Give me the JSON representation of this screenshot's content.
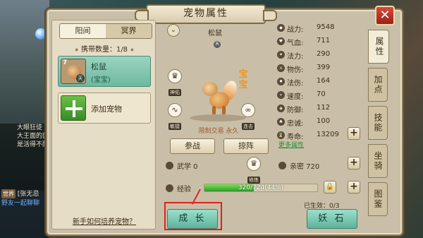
{
  "background": {
    "chat_lines": [
      "大眼狂徒",
      "大王面的面",
      "是活得不耐"
    ],
    "world_tag": "世界",
    "world_msg": "[张无忌",
    "world_msg2": "野友一起聊聊"
  },
  "window": {
    "title": "宠物属性",
    "close_label": "✕"
  },
  "realm_tabs": [
    "阳间",
    "冥界"
  ],
  "carry": "携带数量：1/8",
  "pet": {
    "level": "7",
    "name": "松鼠",
    "subtitle": "(宝宝)",
    "badge": "天"
  },
  "add_pet_label": "添加宠物",
  "howto_link": "新手如何培养宠物？",
  "center": {
    "name": "松鼠",
    "badge": "天",
    "baobao": "宝宝",
    "skills": [
      {
        "icon": "♛",
        "label": "神佑"
      },
      {
        "icon": "∿",
        "label": "敏捷"
      },
      {
        "icon": "♛",
        "label": "防御"
      },
      {
        "icon": "∞",
        "label": "连击"
      }
    ],
    "limited": "限制交易 永久",
    "buttons": [
      "参战",
      "掠阵"
    ]
  },
  "stats": [
    {
      "label": "战力:",
      "value": "9548"
    },
    {
      "label": "气血:",
      "value": "711"
    },
    {
      "label": "法力:",
      "value": "290"
    },
    {
      "label": "物伤:",
      "value": "399"
    },
    {
      "label": "法伤:",
      "value": "164"
    },
    {
      "label": "速度:",
      "value": "70"
    },
    {
      "label": "防御:",
      "value": "112"
    },
    {
      "label": "忠诚:",
      "value": "100"
    },
    {
      "label": "寿命:",
      "value": "13209"
    }
  ],
  "more_attr": "更多属性",
  "wuxue": "武学 0",
  "wuxue_icon_label": "修炼",
  "qinmi": "亲密 720",
  "exp": {
    "label": "经验",
    "text": "320/724(44%)",
    "progress": 0.44
  },
  "effect": "已生效：0/3",
  "bottom_buttons": {
    "grow": "成 长",
    "yaoshi": "妖 石"
  },
  "side_tabs": [
    "属性",
    "加点",
    "技能",
    "坐骑",
    "图鉴"
  ]
}
